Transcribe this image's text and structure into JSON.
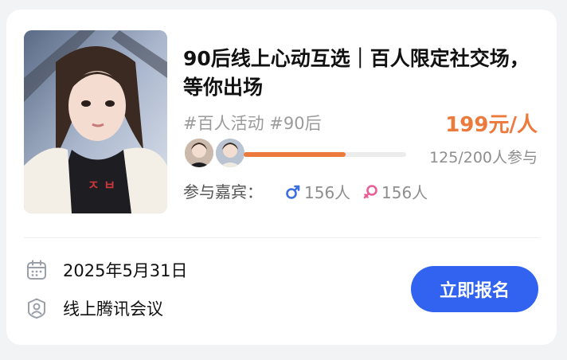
{
  "event": {
    "title": "90后线上心动互选｜百人限定社交场，等你出场",
    "tags": "#百人活动 #90后",
    "price": "199元/人",
    "participants": "125/200人参与",
    "progress_fraction": 0.625,
    "guests_label": "参与嘉宾：",
    "male_count": "156人",
    "female_count": "156人",
    "date": "2025年5月31日",
    "location": "线上腾讯会议",
    "signup_label": "立即报名"
  },
  "colors": {
    "accent": "#ec7a3c",
    "button": "#3162f0",
    "male": "#3b6fe0",
    "female": "#ea5d95"
  },
  "icons": {
    "date": "calendar-icon",
    "location": "location-shield-icon",
    "male": "male-icon",
    "female": "female-icon"
  }
}
